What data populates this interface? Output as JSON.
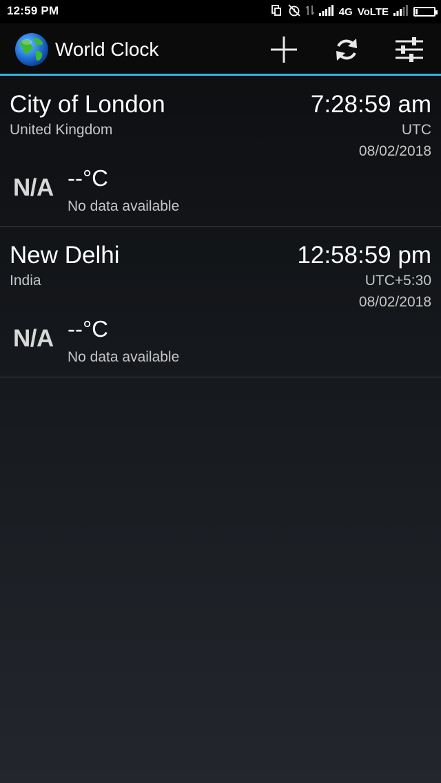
{
  "status_bar": {
    "time": "12:59 PM",
    "network": "4G",
    "volte": "VoLTE"
  },
  "action_bar": {
    "title": "World Clock",
    "accent_color": "#33b5e5"
  },
  "clocks": [
    {
      "city": "City of London",
      "country": "United Kingdom",
      "time": "7:28:59 am",
      "timezone": "UTC",
      "date": "08/02/2018",
      "weather_icon": "N/A",
      "temperature": "--°C",
      "weather_description": "No data available"
    },
    {
      "city": "New Delhi",
      "country": "India",
      "time": "12:58:59 pm",
      "timezone": "UTC+5:30",
      "date": "08/02/2018",
      "weather_icon": "N/A",
      "temperature": "--°C",
      "weather_description": "No data available"
    }
  ]
}
